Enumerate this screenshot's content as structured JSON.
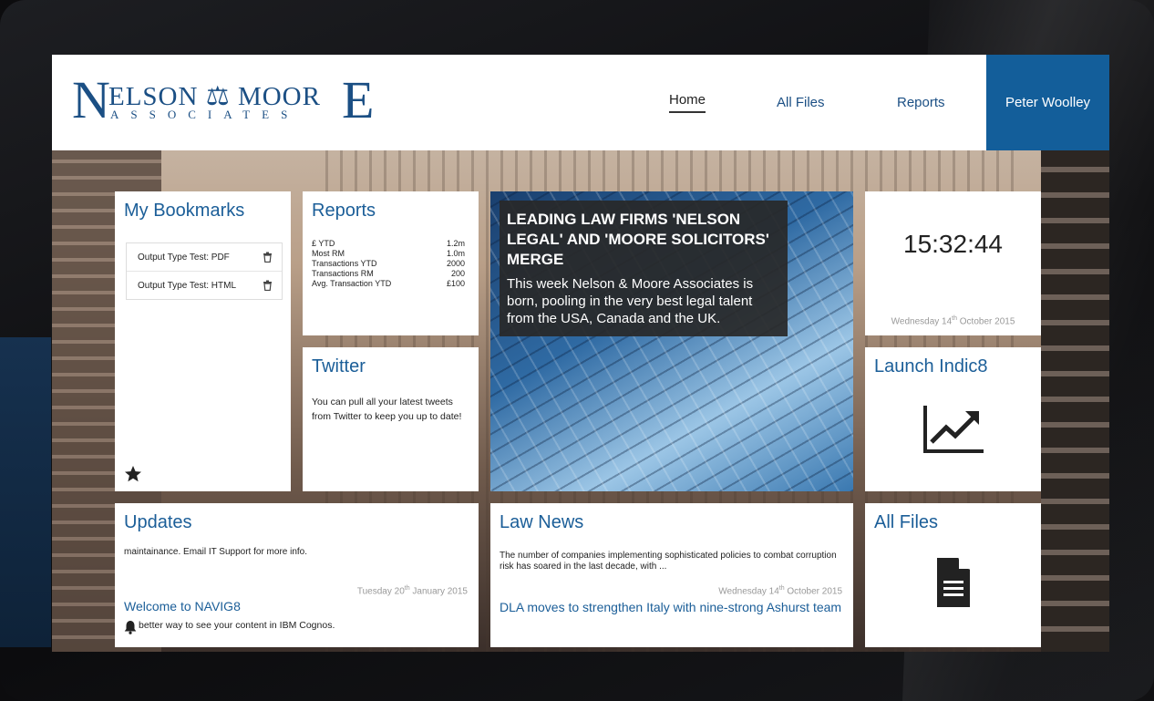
{
  "header": {
    "logo": {
      "first_letter": "N",
      "top": "ELSON ⚖ MOOR",
      "last_letter": "E",
      "sub": "ASSOCIATES"
    },
    "nav": [
      "Home",
      "All Files",
      "Reports"
    ],
    "user": "Peter Woolley"
  },
  "bookmarks": {
    "title": "My Bookmarks",
    "items": [
      "Output Type Test: PDF",
      "Output Type Test: HTML"
    ]
  },
  "reports": {
    "title": "Reports",
    "rows": [
      {
        "label": "£ YTD",
        "value": "1.2m"
      },
      {
        "label": "Most RM",
        "value": "1.0m"
      },
      {
        "label": "Transactions YTD",
        "value": "2000"
      },
      {
        "label": "Transactions RM",
        "value": "200"
      },
      {
        "label": "Avg. Transaction YTD",
        "value": "£100"
      }
    ]
  },
  "twitter": {
    "title": "Twitter",
    "text": "You can pull all your latest tweets from Twitter to keep you up to date!"
  },
  "hero": {
    "headline": "LEADING LAW FIRMS 'NELSON LEGAL' AND 'MOORE SOLICITORS' MERGE",
    "body": "This week Nelson & Moore Associates is born, pooling in the very best legal talent from the USA, Canada and the UK."
  },
  "clock": {
    "time": "15:32:44",
    "date_day": "Wednesday 14",
    "date_sup": "th",
    "date_rest": " October 2015"
  },
  "launch": {
    "title": "Launch Indic8",
    "icon": "trend-chart-icon"
  },
  "updates": {
    "title": "Updates",
    "cut_text": "maintainance. Email IT Support for more info.",
    "date_day": "Tuesday 20",
    "date_sup": "th",
    "date_rest": " January 2015",
    "item_title": "Welcome to NAVIG8",
    "item_text": "better way to see your content in IBM Cognos."
  },
  "law_news": {
    "title": "Law News",
    "text": "The number of companies implementing sophisticated policies to combat corruption risk has soared in the last decade, with ...",
    "date_day": "Wednesday 14",
    "date_sup": "th",
    "date_rest": " October 2015",
    "item_title": "DLA moves to strengthen Italy with nine-strong Ashurst team"
  },
  "all_files": {
    "title": "All Files",
    "icon": "document-icon"
  }
}
